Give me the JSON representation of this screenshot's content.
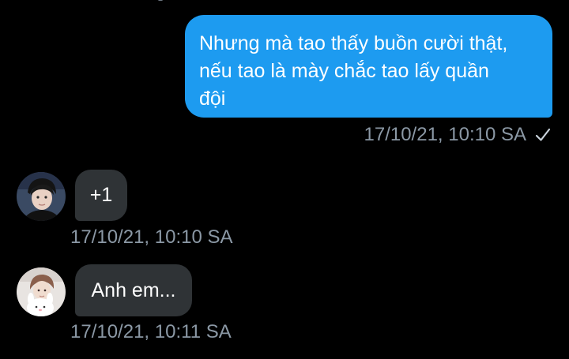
{
  "conversation": {
    "messages": [
      {
        "direction": "outgoing",
        "text": "Nhưng mà tao thấy buồn cười thật,\nnếu tao là mày chắc tao lấy quần\nđội",
        "timestamp": "17/10/21, 10:10 SA",
        "status_icon": "check-icon"
      },
      {
        "direction": "incoming",
        "avatar_icon": "user-avatar-1",
        "text": "+1",
        "timestamp": "17/10/21, 10:10 SA"
      },
      {
        "direction": "incoming",
        "avatar_icon": "user-avatar-2",
        "text": "Anh em...",
        "timestamp": "17/10/21, 10:11 SA"
      }
    ]
  },
  "colors": {
    "background": "#000000",
    "outgoing_bubble": "#1d9bf0",
    "incoming_bubble": "#2f3336",
    "timestamp": "#8b98a5"
  }
}
